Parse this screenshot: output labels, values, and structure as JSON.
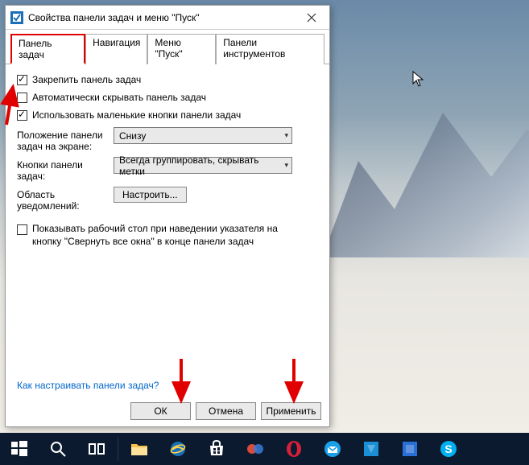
{
  "window": {
    "title": "Свойства панели задач и меню \"Пуск\""
  },
  "tabs": [
    {
      "label": "Панель задач",
      "active": true
    },
    {
      "label": "Навигация",
      "active": false
    },
    {
      "label": "Меню \"Пуск\"",
      "active": false
    },
    {
      "label": "Панели инструментов",
      "active": false
    }
  ],
  "checks": {
    "lock": {
      "label": "Закрепить панель задач",
      "checked": true
    },
    "autohide": {
      "label": "Автоматически скрывать панель задач",
      "checked": false
    },
    "small": {
      "label": "Использовать маленькие кнопки панели задач",
      "checked": true
    }
  },
  "form": {
    "position": {
      "label": "Положение панели задач на экране:",
      "value": "Снизу"
    },
    "buttons": {
      "label": "Кнопки панели задач:",
      "value": "Всегда группировать, скрывать метки"
    },
    "notif": {
      "label": "Область уведомлений:",
      "button": "Настроить..."
    }
  },
  "peek": {
    "label": "Показывать рабочий стол при наведении указателя на кнопку \"Свернуть все окна\" в конце панели задач",
    "checked": false
  },
  "help": "Как настраивать панели задач?",
  "buttons": {
    "ok": "ОК",
    "cancel": "Отмена",
    "apply": "Применить"
  }
}
